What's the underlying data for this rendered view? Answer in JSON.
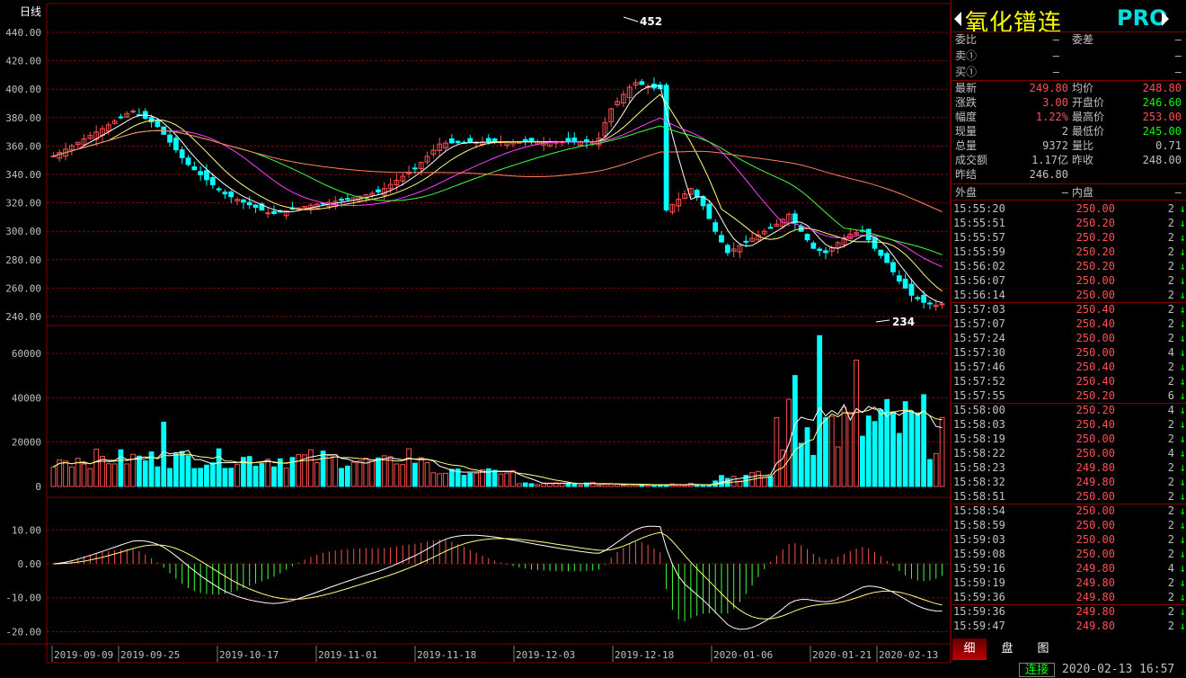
{
  "chart": {
    "period_label": "日线",
    "y_ticks": [
      "440.00",
      "420.00",
      "400.00",
      "380.00",
      "360.00",
      "340.00",
      "320.00",
      "300.00",
      "280.00",
      "260.00",
      "240.00"
    ],
    "y_values": [
      440,
      420,
      400,
      380,
      360,
      340,
      320,
      300,
      280,
      260,
      240
    ],
    "volume_ticks": [
      "60000",
      "40000",
      "20000",
      "0"
    ],
    "volume_values": [
      60000,
      40000,
      20000,
      0
    ],
    "macd_ticks": [
      "10.00",
      "0.00",
      "-10.00",
      "-20.00"
    ],
    "macd_values": [
      10,
      0,
      -10,
      -20
    ],
    "x_dates": [
      "2019-09-09",
      "2019-09-25",
      "2019-10-17",
      "2019-11-01",
      "2019-11-18",
      "2019-12-03",
      "2019-12-18",
      "2020-01-06",
      "2020-01-21",
      "2020-02-13"
    ],
    "high_mark": "452",
    "low_mark": "234",
    "colors": {
      "up": "#ff5050",
      "down": "#00ffff",
      "grid": "#800000",
      "ma5": "#ffffff",
      "ma10": "#ffff80",
      "ma20": "#ff40ff",
      "ma30": "#40ff40",
      "ma60": "#ff8060"
    }
  },
  "chart_data": {
    "type": "candlestick",
    "x": [
      "2019-09-09",
      "2019-09-25",
      "2019-10-17",
      "2019-11-01",
      "2019-11-18",
      "2019-12-03",
      "2019-12-18",
      "2020-01-06",
      "2020-01-21",
      "2020-02-13"
    ],
    "close": [
      353,
      372,
      322,
      324,
      362,
      408,
      330,
      283,
      250,
      249.8
    ],
    "ylim": [
      235,
      445
    ]
  },
  "sidebar": {
    "title": "氧化镨连",
    "badge": "PRO",
    "order_rows": [
      {
        "l1": "委比",
        "v1": "—",
        "l2": "委差",
        "v2": "—"
      },
      {
        "l1": "卖①",
        "v1": "—",
        "l2": "",
        "v2": "—"
      },
      {
        "l1": "买①",
        "v1": "—",
        "l2": "",
        "v2": "—"
      }
    ],
    "quote_rows": [
      {
        "l1": "最新",
        "v1": "249.80",
        "c1": "red",
        "l2": "均价",
        "v2": "248.80",
        "c2": "red"
      },
      {
        "l1": "涨跌",
        "v1": "3.00",
        "c1": "red",
        "l2": "开盘价",
        "v2": "246.60",
        "c2": "grn"
      },
      {
        "l1": "幅度",
        "v1": "1.22%",
        "c1": "red",
        "l2": "最高价",
        "v2": "253.00",
        "c2": "red"
      },
      {
        "l1": "现量",
        "v1": "2",
        "c1": "wht",
        "l2": "最低价",
        "v2": "245.00",
        "c2": "grn"
      },
      {
        "l1": "总量",
        "v1": "9372",
        "c1": "wht",
        "l2": "量比",
        "v2": "0.71",
        "c2": "wht"
      },
      {
        "l1": "成交额",
        "v1": "1.17亿",
        "c1": "wht",
        "l2": "昨收",
        "v2": "248.00",
        "c2": "wht"
      },
      {
        "l1": "昨结",
        "v1": "246.80",
        "c1": "wht",
        "l2": "",
        "v2": "",
        "c2": "wht"
      }
    ],
    "outer_label": "外盘",
    "outer_value": "—",
    "inner_label": "内盘",
    "inner_value": "—",
    "ticks": [
      {
        "t": "15:55:20",
        "p": "250.00",
        "v": "2"
      },
      {
        "t": "15:55:51",
        "p": "250.20",
        "v": "2"
      },
      {
        "t": "15:55:57",
        "p": "250.20",
        "v": "2"
      },
      {
        "t": "15:55:59",
        "p": "250.20",
        "v": "2"
      },
      {
        "t": "15:56:02",
        "p": "250.20",
        "v": "2"
      },
      {
        "t": "15:56:07",
        "p": "250.00",
        "v": "2"
      },
      {
        "t": "15:56:14",
        "p": "250.00",
        "v": "2"
      },
      {
        "t": "15:57:03",
        "p": "250.40",
        "v": "2"
      },
      {
        "t": "15:57:07",
        "p": "250.40",
        "v": "2"
      },
      {
        "t": "15:57:24",
        "p": "250.00",
        "v": "2"
      },
      {
        "t": "15:57:30",
        "p": "250.00",
        "v": "4"
      },
      {
        "t": "15:57:46",
        "p": "250.40",
        "v": "2"
      },
      {
        "t": "15:57:52",
        "p": "250.40",
        "v": "2"
      },
      {
        "t": "15:57:55",
        "p": "250.20",
        "v": "6"
      },
      {
        "t": "15:58:00",
        "p": "250.20",
        "v": "4"
      },
      {
        "t": "15:58:03",
        "p": "250.40",
        "v": "2"
      },
      {
        "t": "15:58:19",
        "p": "250.00",
        "v": "2"
      },
      {
        "t": "15:58:22",
        "p": "250.00",
        "v": "4"
      },
      {
        "t": "15:58:23",
        "p": "249.80",
        "v": "2"
      },
      {
        "t": "15:58:32",
        "p": "249.80",
        "v": "2"
      },
      {
        "t": "15:58:51",
        "p": "250.00",
        "v": "2"
      },
      {
        "t": "15:58:54",
        "p": "250.00",
        "v": "2"
      },
      {
        "t": "15:58:59",
        "p": "250.00",
        "v": "2"
      },
      {
        "t": "15:59:03",
        "p": "250.00",
        "v": "2"
      },
      {
        "t": "15:59:08",
        "p": "250.00",
        "v": "2"
      },
      {
        "t": "15:59:16",
        "p": "249.80",
        "v": "4"
      },
      {
        "t": "15:59:19",
        "p": "249.80",
        "v": "2"
      },
      {
        "t": "15:59:36",
        "p": "249.80",
        "v": "2"
      },
      {
        "t": "15:59:36",
        "p": "249.80",
        "v": "2"
      },
      {
        "t": "15:59:47",
        "p": "249.80",
        "v": "2"
      }
    ],
    "tick_direction_icon": "down-arrow-icon",
    "tabs": [
      "细",
      "盘",
      "图"
    ]
  },
  "status": {
    "connection": "连接",
    "clock": "2020-02-13 16:57"
  }
}
